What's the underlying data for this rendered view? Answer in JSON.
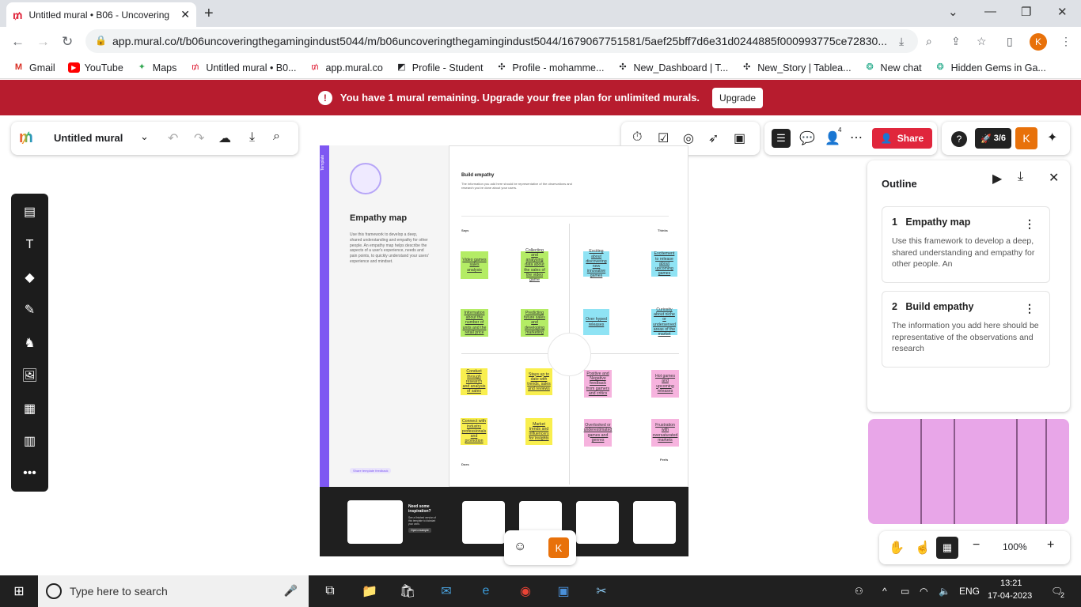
{
  "browser": {
    "tab_title": "Untitled mural • B06 - Uncovering",
    "url": "app.mural.co/t/b06uncoveringthegamingindust5044/m/b06uncoveringthegamingindust5044/1679067751581/5aef25bff7d6e31d0244885f000993775ce72830...",
    "profile_initial": "K",
    "bookmarks": [
      "Gmail",
      "YouTube",
      "Maps",
      "Untitled mural • B0...",
      "app.mural.co",
      "Profile - Student",
      "Profile - mohamme...",
      "New_Dashboard | T...",
      "New_Story | Tablea...",
      "New chat",
      "Hidden Gems in Ga..."
    ]
  },
  "banner": {
    "message": "You have 1 mural remaining. Upgrade your free plan for unlimited murals.",
    "button": "Upgrade"
  },
  "toolbar": {
    "mural_title": "Untitled mural",
    "share": "Share",
    "members_count": "4",
    "progress": "3/6",
    "user_initial": "K"
  },
  "mural": {
    "left": {
      "title": "Empathy map",
      "tag": "Template",
      "description": "Use this framework to develop a deep, shared understanding and empathy for other people. An empathy map helps describe the aspects of a user's experience, needs and pain points, to quickly understand your users' experience and mindset.",
      "feedback": "Share template feedback"
    },
    "right": {
      "heading": "Build empathy",
      "subheading": "The information you add here should be representative of the observations and research you've done about your users.",
      "q_says": "Says",
      "q_thinks": "Thinks",
      "q_does": "Does",
      "q_feels": "Feels"
    },
    "stickies": [
      {
        "text": "Video games sales analysis",
        "color": "g"
      },
      {
        "text": "Collecting and analysing data about the sales of the video game",
        "color": "g"
      },
      {
        "text": "Information about the number of units and the retail price",
        "color": "g"
      },
      {
        "text": "Predicting future sales and developing marketing",
        "color": "g"
      },
      {
        "text": "Exciting about discovering new innovative games",
        "color": "b"
      },
      {
        "text": "Excitement to release about upcoming games",
        "color": "b"
      },
      {
        "text": "Over hyped releases",
        "color": "b"
      },
      {
        "text": "Curiosity about niche or underserved areas of the market",
        "color": "b"
      },
      {
        "text": "Conduct through research and analysis of sales",
        "color": "y"
      },
      {
        "text": "Stays up to date with trends, sales and reviews",
        "color": "y"
      },
      {
        "text": "Connect with industry professionals and promotion",
        "color": "y"
      },
      {
        "text": "Market trends and influencers for insights",
        "color": "y"
      },
      {
        "text": "Positive and Negative feedback from gamers and critics",
        "color": "p"
      },
      {
        "text": "Hot games and upcoming releases",
        "color": "p"
      },
      {
        "text": "Overlooked or underestimated games and genres",
        "color": "p"
      },
      {
        "text": "Frustration with oversaturated markets",
        "color": "p"
      }
    ],
    "promo": {
      "title": "Need some inspiration?",
      "desc": "See a finished version of this template to kickstart your work.",
      "button": "Open example"
    }
  },
  "outline": {
    "title": "Outline",
    "items": [
      {
        "num": "1",
        "title": "Empathy map",
        "desc": "Use this framework to develop a deep, shared understanding and empathy for other people. An"
      },
      {
        "num": "2",
        "title": "Build empathy",
        "desc": "The information you add here should be representative of the observations and research"
      }
    ]
  },
  "zoom": {
    "level": "100%"
  },
  "taskbar": {
    "search_placeholder": "Type here to search",
    "lang": "ENG",
    "time": "13:21",
    "date": "17-04-2023",
    "notif_count": "2"
  }
}
